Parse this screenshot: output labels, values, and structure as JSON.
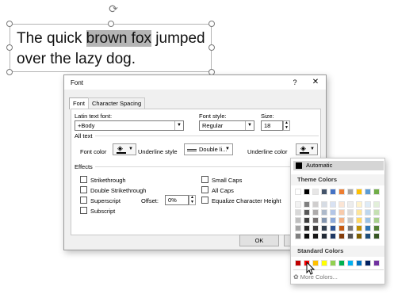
{
  "slide": {
    "text_before": "The quick ",
    "text_selected": "brown fox",
    "text_after": " jumped over the lazy dog."
  },
  "dialog": {
    "title": "Font",
    "help": "?",
    "close": "✕",
    "tabs": [
      "Font",
      "Character Spacing"
    ],
    "latin_font_label": "Latin text font:",
    "latin_font_value": "+Body",
    "font_style_label": "Font style:",
    "font_style_value": "Regular",
    "size_label": "Size:",
    "size_value": "18",
    "all_text_label": "All text",
    "font_color_label": "Font color",
    "underline_style_label": "Underline style",
    "underline_style_value": "Double li...",
    "underline_color_label": "Underline color",
    "effects_label": "Effects",
    "effects_left": [
      "Strikethrough",
      "Double Strikethrough",
      "Superscript",
      "Subscript"
    ],
    "effects_right": [
      "Small Caps",
      "All Caps",
      "Equalize Character Height"
    ],
    "offset_label": "Offset:",
    "offset_value": "0%",
    "ok_label": "OK"
  },
  "palette": {
    "automatic_label": "Automatic",
    "theme_colors_label": "Theme Colors",
    "standard_colors_label": "Standard Colors",
    "more_colors_label": "More Colors...",
    "theme_top": [
      "#ffffff",
      "#000000",
      "#e7e6e6",
      "#44546a",
      "#4472c4",
      "#ed7d31",
      "#a5a5a5",
      "#ffc000",
      "#5b9bd5",
      "#70ad47"
    ],
    "theme_shades": [
      [
        "#f2f2f2",
        "#7f7f7f",
        "#d0cece",
        "#d6dce4",
        "#d9e2f3",
        "#fbe5d5",
        "#ededed",
        "#fff2cc",
        "#deebf6",
        "#e2efd9"
      ],
      [
        "#d8d8d8",
        "#595959",
        "#aeabab",
        "#adb9ca",
        "#b4c6e7",
        "#f7cbac",
        "#dbdbdb",
        "#fee599",
        "#bdd7ee",
        "#c5e0b3"
      ],
      [
        "#bfbfbf",
        "#3f3f3f",
        "#757070",
        "#8496b0",
        "#8eaadb",
        "#f4b183",
        "#c9c9c9",
        "#ffd965",
        "#9cc3e5",
        "#a8d08d"
      ],
      [
        "#a5a5a5",
        "#262626",
        "#3a3838",
        "#323f4f",
        "#2f5496",
        "#c55a11",
        "#7b7b7b",
        "#bf8f00",
        "#2e75b5",
        "#538135"
      ],
      [
        "#7f7f7f",
        "#0c0c0c",
        "#171616",
        "#222a35",
        "#1f3864",
        "#833c0b",
        "#525252",
        "#7f6000",
        "#1e4e79",
        "#375623"
      ]
    ],
    "standard": [
      "#c00000",
      "#ff0000",
      "#ffc000",
      "#ffff00",
      "#92d050",
      "#00b050",
      "#00b0f0",
      "#0070c0",
      "#002060",
      "#7030a0"
    ]
  }
}
